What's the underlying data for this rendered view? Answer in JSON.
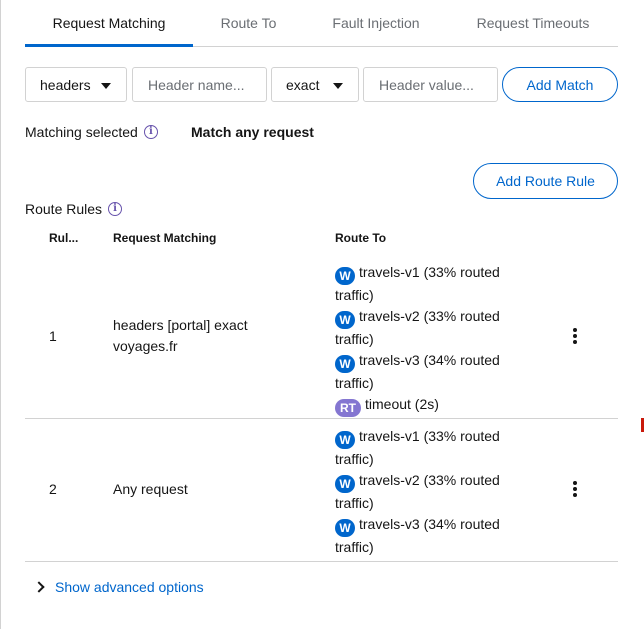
{
  "tabs": [
    "Request Matching",
    "Route To",
    "Fault Injection",
    "Request Timeouts"
  ],
  "match": {
    "type_value": "headers",
    "name_placeholder": "Header name...",
    "op_value": "exact",
    "value_placeholder": "Header value...",
    "add_label": "Add Match"
  },
  "matching": {
    "label": "Matching selected",
    "value": "Match any request"
  },
  "add_route_rule_label": "Add Route Rule",
  "route_rules": {
    "label": "Route Rules",
    "columns": [
      "Rul...",
      "Request Matching",
      "Route To"
    ],
    "rows": [
      {
        "num": "1",
        "matching": "headers [portal] exact voyages.fr",
        "routes": [
          {
            "badge": "W",
            "text": "travels-v1 (33% routed traffic)"
          },
          {
            "badge": "W",
            "text": "travels-v2 (33% routed traffic)"
          },
          {
            "badge": "W",
            "text": "travels-v3 (34% routed traffic)"
          },
          {
            "badge": "RT",
            "text": "timeout (2s)"
          }
        ]
      },
      {
        "num": "2",
        "matching": "Any request",
        "routes": [
          {
            "badge": "W",
            "text": "travels-v1 (33% routed traffic)"
          },
          {
            "badge": "W",
            "text": "travels-v2 (33% routed traffic)"
          },
          {
            "badge": "W",
            "text": "travels-v3 (34% routed traffic)"
          }
        ]
      }
    ]
  },
  "advanced_label": "Show advanced options",
  "colors": {
    "accent": "#0066cc",
    "info": "#6753ac",
    "rt_badge": "#8476d1",
    "border": "#d2d2d2"
  }
}
